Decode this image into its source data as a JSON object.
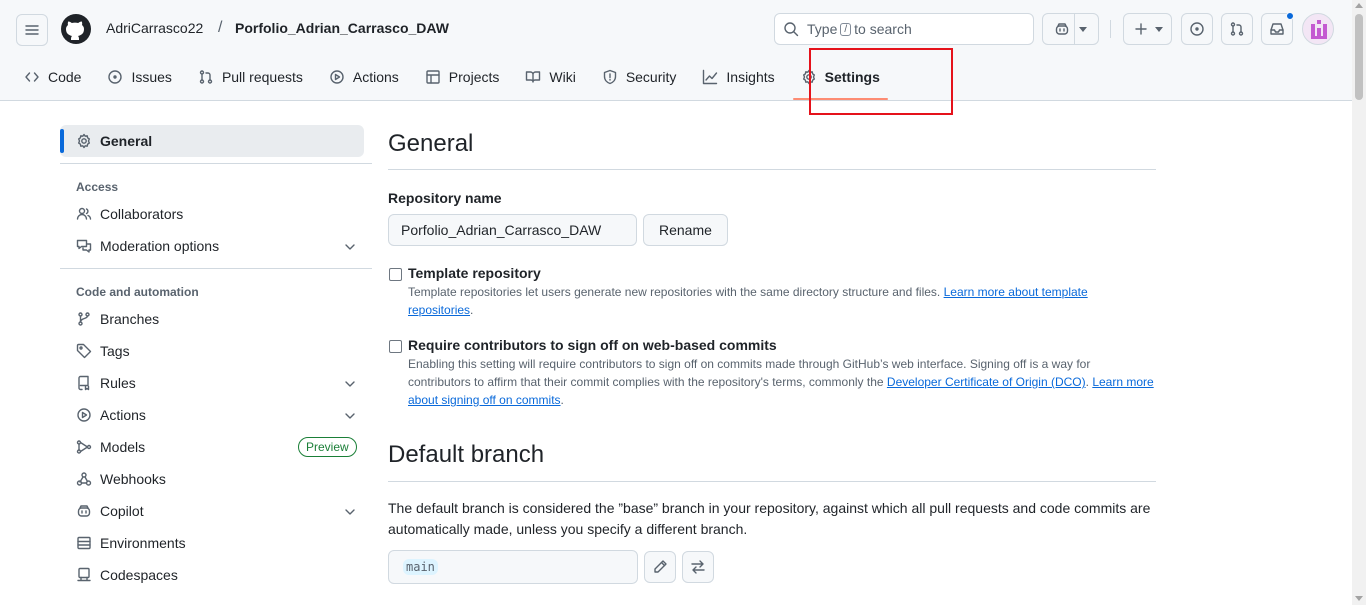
{
  "header": {
    "owner": "AdriCarrasco22",
    "separator": "/",
    "repo": "Porfolio_Adrian_Carrasco_DAW",
    "search_prefix": "Type",
    "search_key": "/",
    "search_suffix": "to search"
  },
  "tabs": [
    {
      "label": "Code",
      "icon": "code-icon"
    },
    {
      "label": "Issues",
      "icon": "issue-icon"
    },
    {
      "label": "Pull requests",
      "icon": "pull-request-icon"
    },
    {
      "label": "Actions",
      "icon": "play-icon"
    },
    {
      "label": "Projects",
      "icon": "table-icon"
    },
    {
      "label": "Wiki",
      "icon": "book-icon"
    },
    {
      "label": "Security",
      "icon": "shield-icon"
    },
    {
      "label": "Insights",
      "icon": "graph-icon"
    },
    {
      "label": "Settings",
      "icon": "gear-icon",
      "active": true
    }
  ],
  "sidebar": {
    "general": "General",
    "access_heading": "Access",
    "access_items": [
      "Collaborators",
      "Moderation options"
    ],
    "code_heading": "Code and automation",
    "code_items": [
      "Branches",
      "Tags",
      "Rules",
      "Actions",
      "Models",
      "Webhooks",
      "Copilot",
      "Environments",
      "Codespaces"
    ],
    "models_badge": "Preview"
  },
  "main": {
    "title": "General",
    "repo_name_label": "Repository name",
    "repo_name_value": "Porfolio_Adrian_Carrasco_DAW",
    "rename_label": "Rename",
    "template": {
      "title": "Template repository",
      "desc": "Template repositories let users generate new repositories with the same directory structure and files. ",
      "link": "Learn more about template repositories",
      "end": "."
    },
    "signoff": {
      "title": "Require contributors to sign off on web-based commits",
      "desc": "Enabling this setting will require contributors to sign off on commits made through GitHub’s web interface. Signing off is a way for contributors to affirm that their commit complies with the repository's terms, commonly the ",
      "link1": "Developer Certificate of Origin (DCO)",
      "mid": ". ",
      "link2": "Learn more about signing off on commits",
      "end": "."
    },
    "default_branch_title": "Default branch",
    "default_branch_desc": "The default branch is considered the ”base” branch in your repository, against which all pull requests and code commits are automatically made, unless you specify a different branch.",
    "default_branch_value": "main"
  },
  "colors": {
    "accent": "#0969da",
    "tab_underline": "#fd8c73",
    "highlight": "#e5121b",
    "preview_green": "#1a7f37"
  }
}
